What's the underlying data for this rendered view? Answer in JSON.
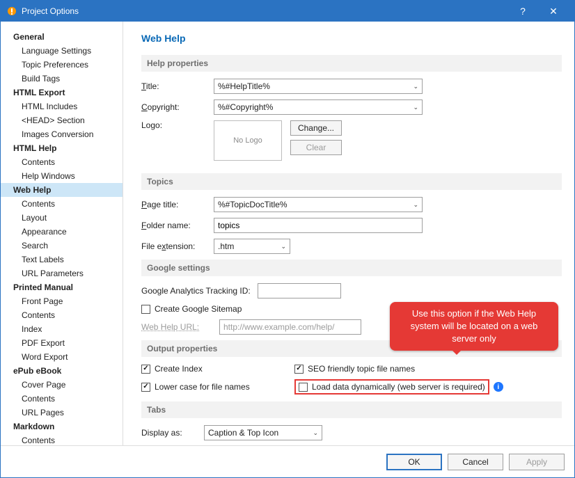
{
  "window": {
    "title": "Project Options"
  },
  "sidebar": {
    "groups": [
      {
        "label": "General",
        "items": [
          "Language Settings",
          "Topic Preferences",
          "Build Tags"
        ]
      },
      {
        "label": "HTML Export",
        "items": [
          "HTML Includes",
          "<HEAD> Section",
          "Images Conversion"
        ]
      },
      {
        "label": "HTML Help",
        "items": [
          "Contents",
          "Help Windows"
        ]
      },
      {
        "label": "Web Help",
        "selected": true,
        "items": [
          "Contents",
          "Layout",
          "Appearance",
          "Search",
          "Text Labels",
          "URL Parameters"
        ]
      },
      {
        "label": "Printed Manual",
        "items": [
          "Front Page",
          "Contents",
          "Index",
          "PDF Export",
          "Word Export"
        ]
      },
      {
        "label": "ePub eBook",
        "items": [
          "Cover Page",
          "Contents",
          "URL Pages"
        ]
      },
      {
        "label": "Markdown",
        "items": [
          "Contents"
        ]
      }
    ]
  },
  "main": {
    "heading": "Web Help",
    "help_section": {
      "title": "Help properties",
      "title_label": "Title:",
      "title_value": "%#HelpTitle%",
      "copyright_label": "Copyright:",
      "copyright_value": "%#Copyright%",
      "logo_label": "Logo:",
      "logo_placeholder": "No Logo",
      "change_btn": "Change...",
      "clear_btn": "Clear"
    },
    "topics_section": {
      "title": "Topics",
      "page_title_label": "Page title:",
      "page_title_value": "%#TopicDocTitle%",
      "folder_label": "Folder name:",
      "folder_value": "topics",
      "ext_label": "File extension:",
      "ext_value": ".htm"
    },
    "google_section": {
      "title": "Google settings",
      "ga_label": "Google Analytics Tracking ID:",
      "ga_value": "",
      "sitemap_label": "Create Google Sitemap",
      "url_label": "Web Help URL:",
      "url_value": "http://www.example.com/help/"
    },
    "output_section": {
      "title": "Output properties",
      "create_index": "Create Index",
      "lowercase": "Lower case for file names",
      "seo": "SEO friendly topic file names",
      "dynamic": "Load data dynamically (web server is required)"
    },
    "tabs_section": {
      "title": "Tabs",
      "display_label": "Display as:",
      "display_value": "Caption & Top Icon"
    }
  },
  "callout": {
    "text": "Use this option if the Web Help system will be located on a web server only"
  },
  "footer": {
    "ok": "OK",
    "cancel": "Cancel",
    "apply": "Apply"
  }
}
